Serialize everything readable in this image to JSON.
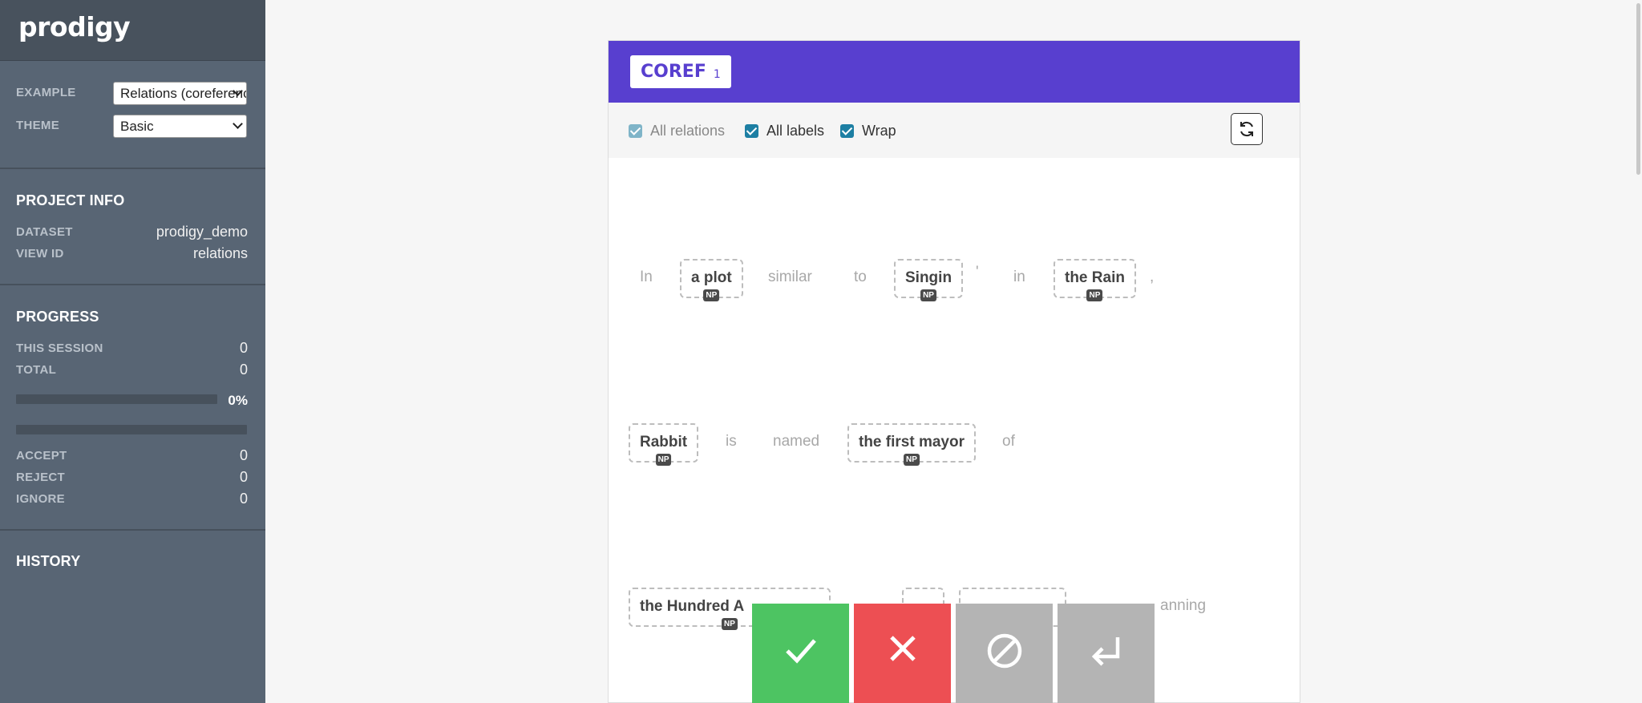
{
  "app": {
    "logo": "prodigy"
  },
  "sidebar": {
    "settings": {
      "example_label": "EXAMPLE",
      "example_value": "Relations (coreference)",
      "theme_label": "THEME",
      "theme_value": "Basic"
    },
    "project_info": {
      "title": "PROJECT INFO",
      "dataset_label": "DATASET",
      "dataset_value": "prodigy_demo",
      "view_id_label": "VIEW ID",
      "view_id_value": "relations"
    },
    "progress": {
      "title": "PROGRESS",
      "this_session_label": "THIS SESSION",
      "this_session_value": "0",
      "total_label": "TOTAL",
      "total_value": "0",
      "percent": "0%",
      "progress_fraction": 0,
      "accept_label": "ACCEPT",
      "accept_value": "0",
      "reject_label": "REJECT",
      "reject_value": "0",
      "ignore_label": "IGNORE",
      "ignore_value": "0"
    },
    "history": {
      "title": "HISTORY"
    }
  },
  "card": {
    "label": "COREF",
    "count": "1",
    "toolbar": {
      "all_relations": "All relations",
      "all_labels": "All labels",
      "wrap": "Wrap"
    },
    "tokens": {
      "in": "In",
      "a_plot": "a plot",
      "similar": "similar",
      "to": "to",
      "singin": "Singin",
      "apos": "'",
      "in2": "in",
      "the_rain": "the Rain",
      "comma": ",",
      "rabbit": "Rabbit",
      "is": "is",
      "named": "named",
      "the_first_mayor": "the first mayor",
      "of": "of",
      "the_hundred_a": "the Hundred A",
      "anning": "anning"
    },
    "span_label": "NP"
  },
  "actions": {
    "accept": "✓",
    "reject": "✕",
    "ignore": "⊘",
    "undo": "↵"
  },
  "colors": {
    "accent": "#583fcf",
    "accept": "#4dc462",
    "reject": "#ed4f53",
    "neutral": "#b4b4b4",
    "sidebar": "#586574"
  }
}
